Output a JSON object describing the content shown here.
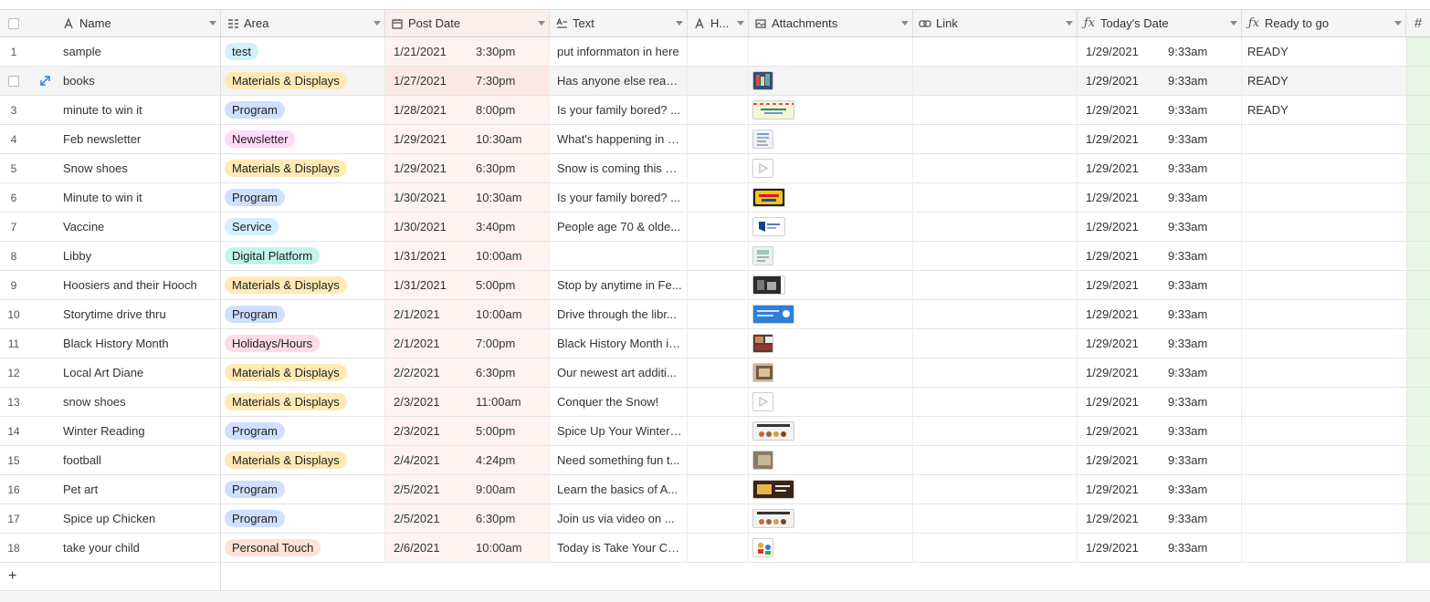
{
  "columns": {
    "name": "Name",
    "area": "Area",
    "post_date": "Post Date",
    "text": "Text",
    "h": "H...",
    "attachments": "Attachments",
    "link": "Link",
    "todays_date": "Today's Date",
    "ready": "Ready to go",
    "last": "#"
  },
  "add_row_label": "+",
  "colors": {
    "date_column_tint": "#fff3f1",
    "last_column_tint": "#eaf7e6",
    "header_bg": "#f5f5f5"
  },
  "rows": [
    {
      "num": "1",
      "name": "sample",
      "area": "test",
      "area_color": "test",
      "date": "1/21/2021",
      "time": "3:30pm",
      "text": "put infornmaton in here",
      "attachment": "",
      "today_date": "1/29/2021",
      "today_time": "9:33am",
      "ready": "READY"
    },
    {
      "num": "2",
      "name": "books",
      "area": "Materials & Displays",
      "area_color": "mat",
      "date": "1/27/2021",
      "time": "7:30pm",
      "text": "Has anyone else read...",
      "attachment": "photo-books",
      "today_date": "1/29/2021",
      "today_time": "9:33am",
      "ready": "READY"
    },
    {
      "num": "3",
      "name": "minute to win it",
      "area": "Program",
      "area_color": "prog",
      "date": "1/28/2021",
      "time": "8:00pm",
      "text": "Is your family bored? ...",
      "attachment": "flyer-banner",
      "today_date": "1/29/2021",
      "today_time": "9:33am",
      "ready": "READY"
    },
    {
      "num": "4",
      "name": "Feb newsletter",
      "area": "Newsletter",
      "area_color": "news",
      "date": "1/29/2021",
      "time": "10:30am",
      "text": "What's happening in F...",
      "attachment": "document",
      "today_date": "1/29/2021",
      "today_time": "9:33am",
      "ready": ""
    },
    {
      "num": "5",
      "name": "Snow shoes",
      "area": "Materials & Displays",
      "area_color": "mat",
      "date": "1/29/2021",
      "time": "6:30pm",
      "text": "Snow is coming this w...",
      "attachment": "video",
      "today_date": "1/29/2021",
      "today_time": "9:33am",
      "ready": ""
    },
    {
      "num": "6",
      "name": "Minute to win it",
      "area": "Program",
      "area_color": "prog",
      "date": "1/30/2021",
      "time": "10:30am",
      "text": "Is your family bored? ...",
      "attachment": "minute-logo",
      "today_date": "1/29/2021",
      "today_time": "9:33am",
      "ready": ""
    },
    {
      "num": "7",
      "name": "Vaccine",
      "area": "Service",
      "area_color": "serv",
      "date": "1/30/2021",
      "time": "3:40pm",
      "text": "People age 70 & olde...",
      "attachment": "graphic",
      "today_date": "1/29/2021",
      "today_time": "9:33am",
      "ready": ""
    },
    {
      "num": "8",
      "name": "Libby",
      "area": "Digital Platform",
      "area_color": "dig",
      "date": "1/31/2021",
      "time": "10:00am",
      "text": "",
      "attachment": "document-2",
      "today_date": "1/29/2021",
      "today_time": "9:33am",
      "ready": ""
    },
    {
      "num": "9",
      "name": "Hoosiers and their Hooch",
      "area": "Materials & Displays",
      "area_color": "mat",
      "date": "1/31/2021",
      "time": "5:00pm",
      "text": "Stop by anytime in Fe...",
      "attachment": "photo-dark",
      "today_date": "1/29/2021",
      "today_time": "9:33am",
      "ready": ""
    },
    {
      "num": "10",
      "name": "Storytime drive thru",
      "area": "Program",
      "area_color": "prog",
      "date": "2/1/2021",
      "time": "10:00am",
      "text": "Drive through the libr...",
      "attachment": "blue-flyer",
      "today_date": "1/29/2021",
      "today_time": "9:33am",
      "ready": ""
    },
    {
      "num": "11",
      "name": "Black History Month",
      "area": "Holidays/Hours",
      "area_color": "hol",
      "date": "2/1/2021",
      "time": "7:00pm",
      "text": "Black History Month is...",
      "attachment": "photo-collage",
      "today_date": "1/29/2021",
      "today_time": "9:33am",
      "ready": ""
    },
    {
      "num": "12",
      "name": "Local Art Diane",
      "area": "Materials & Displays",
      "area_color": "mat",
      "date": "2/2/2021",
      "time": "6:30pm",
      "text": "Our newest art additi...",
      "attachment": "painting",
      "today_date": "1/29/2021",
      "today_time": "9:33am",
      "ready": ""
    },
    {
      "num": "13",
      "name": "snow shoes",
      "area": "Materials & Displays",
      "area_color": "mat",
      "date": "2/3/2021",
      "time": "11:00am",
      "text": "Conquer the Snow!",
      "attachment": "video",
      "today_date": "1/29/2021",
      "today_time": "9:33am",
      "ready": ""
    },
    {
      "num": "14",
      "name": "Winter Reading",
      "area": "Program",
      "area_color": "prog",
      "date": "2/3/2021",
      "time": "5:00pm",
      "text": "Spice Up Your Winter ...",
      "attachment": "spice-flyer",
      "today_date": "1/29/2021",
      "today_time": "9:33am",
      "ready": ""
    },
    {
      "num": "15",
      "name": "football",
      "area": "Materials & Displays",
      "area_color": "mat",
      "date": "2/4/2021",
      "time": "4:24pm",
      "text": "Need something fun t...",
      "attachment": "photo-small",
      "today_date": "1/29/2021",
      "today_time": "9:33am",
      "ready": ""
    },
    {
      "num": "16",
      "name": "Pet art",
      "area": "Program",
      "area_color": "prog",
      "date": "2/5/2021",
      "time": "9:00am",
      "text": "Learn the basics of A...",
      "attachment": "dark-flyer",
      "today_date": "1/29/2021",
      "today_time": "9:33am",
      "ready": ""
    },
    {
      "num": "17",
      "name": "Spice up Chicken",
      "area": "Program",
      "area_color": "prog",
      "date": "2/5/2021",
      "time": "6:30pm",
      "text": "Join us via video on ...",
      "attachment": "spice-flyer",
      "today_date": "1/29/2021",
      "today_time": "9:33am",
      "ready": ""
    },
    {
      "num": "18",
      "name": "take your child",
      "area": "Personal Touch",
      "area_color": "pers",
      "date": "2/6/2021",
      "time": "10:00am",
      "text": "Today is Take Your Ch...",
      "attachment": "clipart",
      "today_date": "1/29/2021",
      "today_time": "9:33am",
      "ready": ""
    }
  ]
}
